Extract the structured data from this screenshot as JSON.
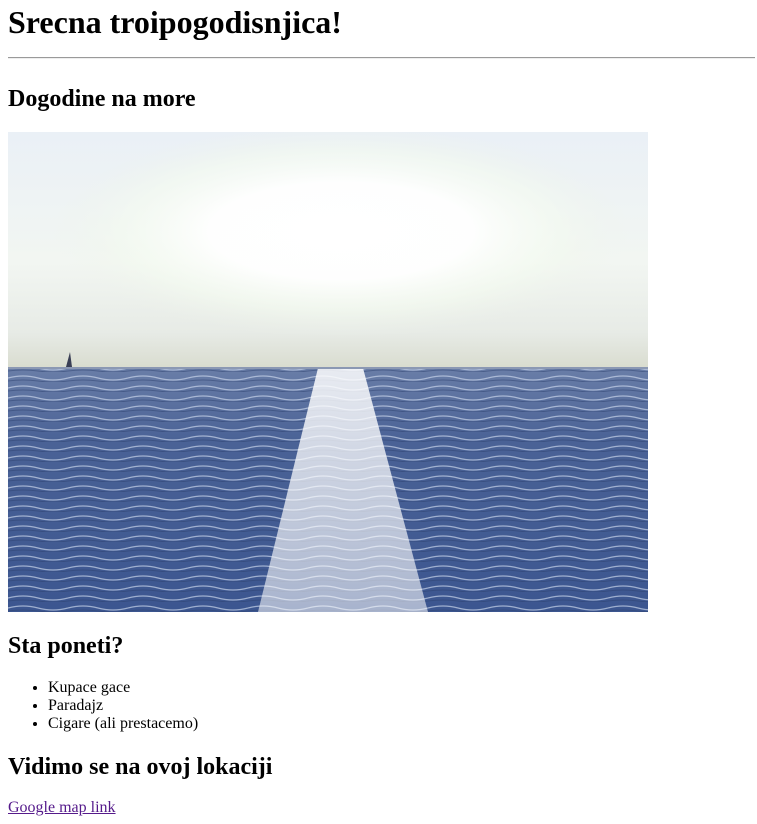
{
  "page": {
    "title": "Srecna troipogodisnjica!",
    "section_trip": {
      "heading": "Dogodine na more",
      "image_description_icon": "sea-sunset-photo"
    },
    "section_packing": {
      "heading": "Sta poneti?",
      "items": [
        "Kupace gace",
        "Paradajz",
        "Cigare (ali prestacemo)"
      ]
    },
    "section_location": {
      "heading": "Vidimo se na ovoj lokaciji",
      "link_label": "Google map link"
    }
  },
  "colors": {
    "link_visited": "#551a8b",
    "text": "#000000",
    "rule": "#9a9a9a"
  }
}
